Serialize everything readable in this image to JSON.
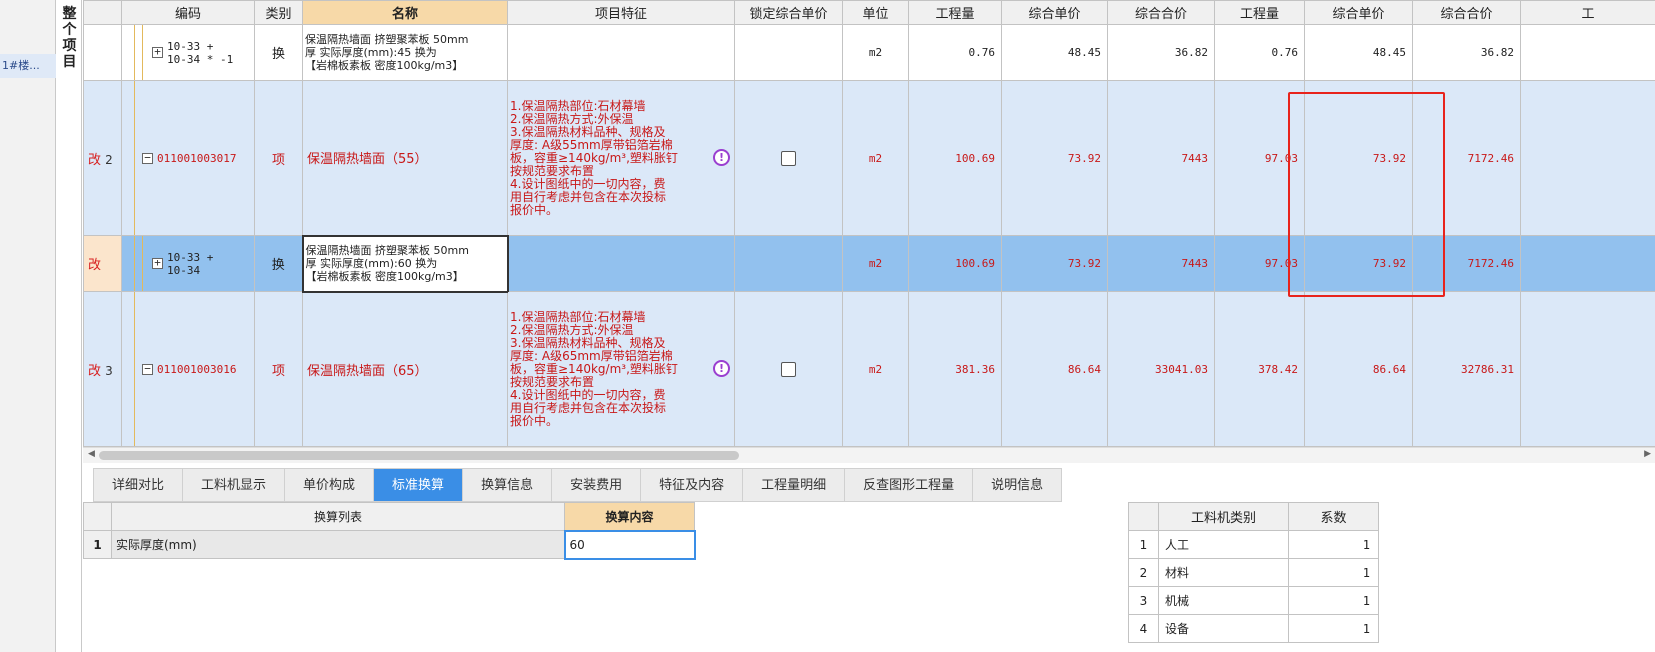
{
  "left_panel": {
    "item": "1#楼..."
  },
  "vertical_label": "整个项目",
  "columns": {
    "col_code": "编码",
    "col_type": "类别",
    "col_name": "名称",
    "col_feature": "项目特征",
    "col_lock": "锁定综合单价",
    "col_unit": "单位",
    "col_qty1": "工程量",
    "col_uprice1": "综合单价",
    "col_total1": "综合合价",
    "col_qty2": "工程量",
    "col_uprice2": "综合单价",
    "col_total2": "综合合价",
    "col_extra": "工"
  },
  "rows": [
    {
      "mark": "",
      "num": "",
      "code": "10-33 +\n10-34 * -1",
      "type": "换",
      "name": "保温隔热墙面 挤塑聚苯板 50mm\n厚  实际厚度(mm):45  换为\n【岩棉板素板 密度100kg/m3】",
      "feature": "",
      "unit": "m2",
      "qty1": "0.76",
      "uprice1": "48.45",
      "total1": "36.82",
      "qty2": "0.76",
      "uprice2": "48.45",
      "total2": "36.82"
    },
    {
      "mark": "改",
      "num": "2",
      "code": "011001003017",
      "type": "项",
      "name": "保温隔热墙面（55）",
      "feature": "1.保温隔热部位:石材幕墙\n2.保温隔热方式:外保温\n3.保温隔热材料品种、规格及\n厚度: A级55mm厚带铝箔岩棉\n板，容重≥140kg/m³,塑料胀钉\n按规范要求布置\n4.设计图纸中的一切内容，费\n用自行考虑并包含在本次投标\n报价中。",
      "unit": "m2",
      "qty1": "100.69",
      "uprice1": "73.92",
      "total1": "7443",
      "qty2": "97.03",
      "uprice2": "73.92",
      "total2": "7172.46"
    },
    {
      "mark": "改",
      "num": "",
      "code": "10-33 +\n10-34",
      "type": "换",
      "name": "保温隔热墙面 挤塑聚苯板 50mm\n厚  实际厚度(mm):60  换为\n【岩棉板素板 密度100kg/m3】",
      "feature": "",
      "unit": "m2",
      "qty1": "100.69",
      "uprice1": "73.92",
      "total1": "7443",
      "qty2": "97.03",
      "uprice2": "73.92",
      "total2": "7172.46"
    },
    {
      "mark": "改",
      "num": "3",
      "code": "011001003016",
      "type": "项",
      "name": "保温隔热墙面（65）",
      "feature": "1.保温隔热部位:石材幕墙\n2.保温隔热方式:外保温\n3.保温隔热材料品种、规格及\n厚度: A级65mm厚带铝箔岩棉\n板，容重≥140kg/m³,塑料胀钉\n按规范要求布置\n4.设计图纸中的一切内容，费\n用自行考虑并包含在本次投标\n报价中。",
      "unit": "m2",
      "qty1": "381.36",
      "uprice1": "86.64",
      "total1": "33041.03",
      "qty2": "378.42",
      "uprice2": "86.64",
      "total2": "32786.31"
    }
  ],
  "tabs": [
    "详细对比",
    "工料机显示",
    "单价构成",
    "标准换算",
    "换算信息",
    "安装费用",
    "特征及内容",
    "工程量明细",
    "反查图形工程量",
    "说明信息"
  ],
  "active_tab": "标准换算",
  "conversion": {
    "head_list": "换算列表",
    "head_content": "换算内容",
    "rows": [
      {
        "index": "1",
        "label": "实际厚度(mm)",
        "value": "60"
      }
    ]
  },
  "coefficients": {
    "head_category": "工料机类别",
    "head_coef": "系数",
    "rows": [
      {
        "index": "1",
        "category": "人工",
        "coef": "1"
      },
      {
        "index": "2",
        "category": "材料",
        "coef": "1"
      },
      {
        "index": "3",
        "category": "机械",
        "coef": "1"
      },
      {
        "index": "4",
        "category": "设备",
        "coef": "1"
      }
    ]
  },
  "colors": {
    "accent": "#3a8ee6",
    "highlight_box": "#e8231c",
    "modified_text": "#c81818",
    "selected_row": "#92c1ee",
    "item_row": "#dbe8f8"
  }
}
